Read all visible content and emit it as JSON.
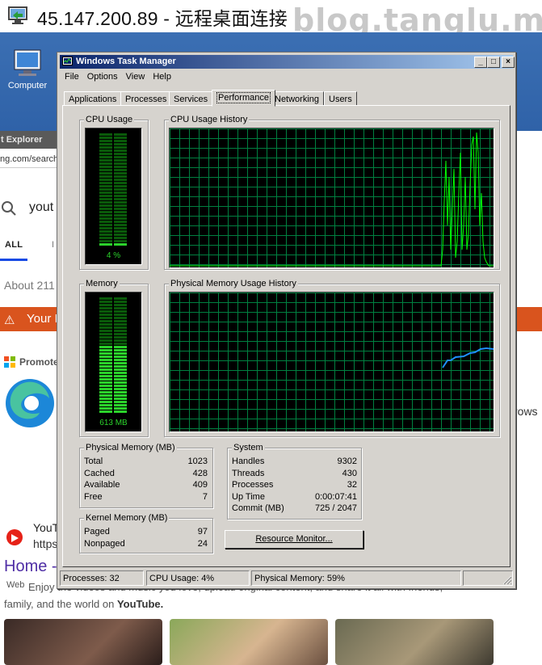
{
  "rdp": {
    "title": "45.147.200.89 - 远程桌面连接",
    "watermark": "blog.tanglu.me"
  },
  "desktop": {
    "icon_label": "Computer"
  },
  "browser": {
    "title_fragment": "t Explorer",
    "url_fragment": "ng.com/search",
    "search_text": "yout",
    "tab_all": "ALL",
    "tab_next": "I",
    "about_text": "About 211",
    "warning_text": "Your I",
    "promo_text": "Promote",
    "edge_side_text": "rows",
    "youtube_name": "YouT",
    "youtube_url": "https",
    "home_link": "Home -",
    "web_label": "Web",
    "desc_line1": "Enjoy the videos and music you love, upload original content, and share it all with friends,",
    "desc_line2_prefix": "family, and the world on ",
    "desc_line2_bold": "YouTube."
  },
  "task_manager": {
    "title": "Windows Task Manager",
    "menu": [
      "File",
      "Options",
      "View",
      "Help"
    ],
    "tabs": [
      "Applications",
      "Processes",
      "Services",
      "Performance",
      "Networking",
      "Users"
    ],
    "active_tab": "Performance",
    "cpu_usage": {
      "label": "CPU Usage",
      "value_text": "4 %",
      "percent": 4
    },
    "cpu_history": {
      "label": "CPU Usage History"
    },
    "memory": {
      "label": "Memory",
      "value_text": "613 MB",
      "percent": 59
    },
    "memory_history": {
      "label": "Physical Memory Usage History"
    },
    "physical_memory": {
      "label": "Physical Memory (MB)",
      "rows": [
        {
          "name": "Total",
          "value": "1023"
        },
        {
          "name": "Cached",
          "value": "428"
        },
        {
          "name": "Available",
          "value": "409"
        },
        {
          "name": "Free",
          "value": "7"
        }
      ]
    },
    "kernel_memory": {
      "label": "Kernel Memory (MB)",
      "rows": [
        {
          "name": "Paged",
          "value": "97"
        },
        {
          "name": "Nonpaged",
          "value": "24"
        }
      ]
    },
    "system": {
      "label": "System",
      "rows": [
        {
          "name": "Handles",
          "value": "9302"
        },
        {
          "name": "Threads",
          "value": "430"
        },
        {
          "name": "Processes",
          "value": "32"
        },
        {
          "name": "Up Time",
          "value": "0:00:07:41"
        },
        {
          "name": "Commit (MB)",
          "value": "725 / 2047"
        }
      ]
    },
    "resource_monitor_button": "Resource Monitor...",
    "status": {
      "processes": "Processes: 32",
      "cpu": "CPU Usage: 4%",
      "memory": "Physical Memory: 59%"
    },
    "colors": {
      "graph_grid": "#008040",
      "cpu_line": "#00ff00",
      "mem_line": "#1e90ff",
      "meter_on": "#2bd22b",
      "meter_off": "#0a5a0a"
    }
  }
}
